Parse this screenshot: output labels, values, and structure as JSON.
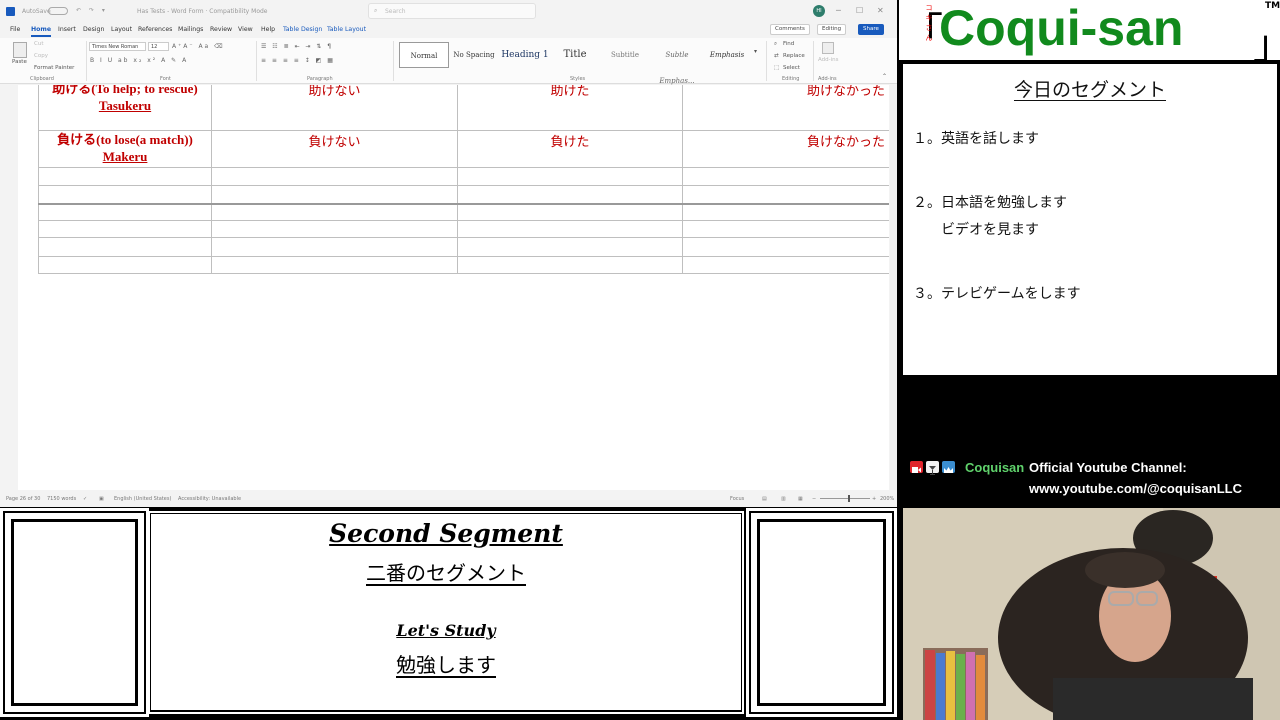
{
  "word": {
    "titlebar": {
      "autosave": "AutoSave",
      "doc_title": "Has Tests - Word Form · Compatibility Mode",
      "search_placeholder": "Search",
      "avatar_initials": "HI"
    },
    "tabs": [
      "File",
      "Home",
      "Insert",
      "Design",
      "Layout",
      "References",
      "Mailings",
      "Review",
      "View",
      "Help",
      "Table Design",
      "Table Layout"
    ],
    "active_tab": "Home",
    "buttons": {
      "comments": "Comments",
      "editing": "Editing",
      "share": "Share"
    },
    "ribbon": {
      "clipboard": {
        "paste": "Paste",
        "cut": "Cut",
        "copy": "Copy",
        "format_painter": "Format Painter",
        "label": "Clipboard"
      },
      "font": {
        "name": "Times New Roman",
        "size": "12",
        "label": "Font"
      },
      "paragraph_label": "Paragraph",
      "styles": [
        "Normal",
        "No Spacing",
        "Heading 1",
        "Title",
        "Subtitle",
        "Subtle Emphas...",
        "Emphasis"
      ],
      "styles_label": "Styles",
      "editing": {
        "find": "Find",
        "replace": "Replace",
        "select": "Select",
        "label": "Editing"
      },
      "addins": {
        "button": "Add-ins",
        "label": "Add-ins"
      }
    },
    "table": {
      "rows": [
        {
          "jp": "助ける(To help; to rescue)",
          "romaji": "Tasukeru",
          "neg": "助けない",
          "past": "助けた",
          "past_neg": "助けなかった"
        },
        {
          "jp": "負ける(to lose(a match))",
          "romaji": "Makeru",
          "neg": "負けない",
          "past": "負けた",
          "past_neg": "負けなかった"
        }
      ]
    },
    "status": {
      "page": "Page 26 of 30",
      "words": "7150 words",
      "language": "English (United States)",
      "accessibility": "Accessibility: Unavailable",
      "focus": "Focus",
      "zoom": "200%"
    }
  },
  "brand": {
    "furigana": [
      "コ",
      "キ",
      "さ",
      "ん"
    ],
    "name": "Coqui-san",
    "bracket_open": "「",
    "bracket_close": "」",
    "tm": "TM"
  },
  "segments": {
    "title": "今日のセグメント",
    "items": [
      "１。英語を話します",
      "２。日本語を勉強します",
      "ビデオを見ます",
      "３。テレビゲームをします"
    ]
  },
  "channel": {
    "brandname": "Coquisan",
    "official": "Official Youtube Channel:",
    "url": "www.youtube.com/@coquisanLLC"
  },
  "now": {
    "segment_en": "Second Segment",
    "segment_jp": "二番のセグメント",
    "activity_en": "Let's Study",
    "activity_jp": "勉強します"
  },
  "colors": {
    "brand_green": "#118a1d",
    "channel_green": "#5fd16b",
    "word_blue": "#185abd",
    "table_red": "#c00000"
  }
}
